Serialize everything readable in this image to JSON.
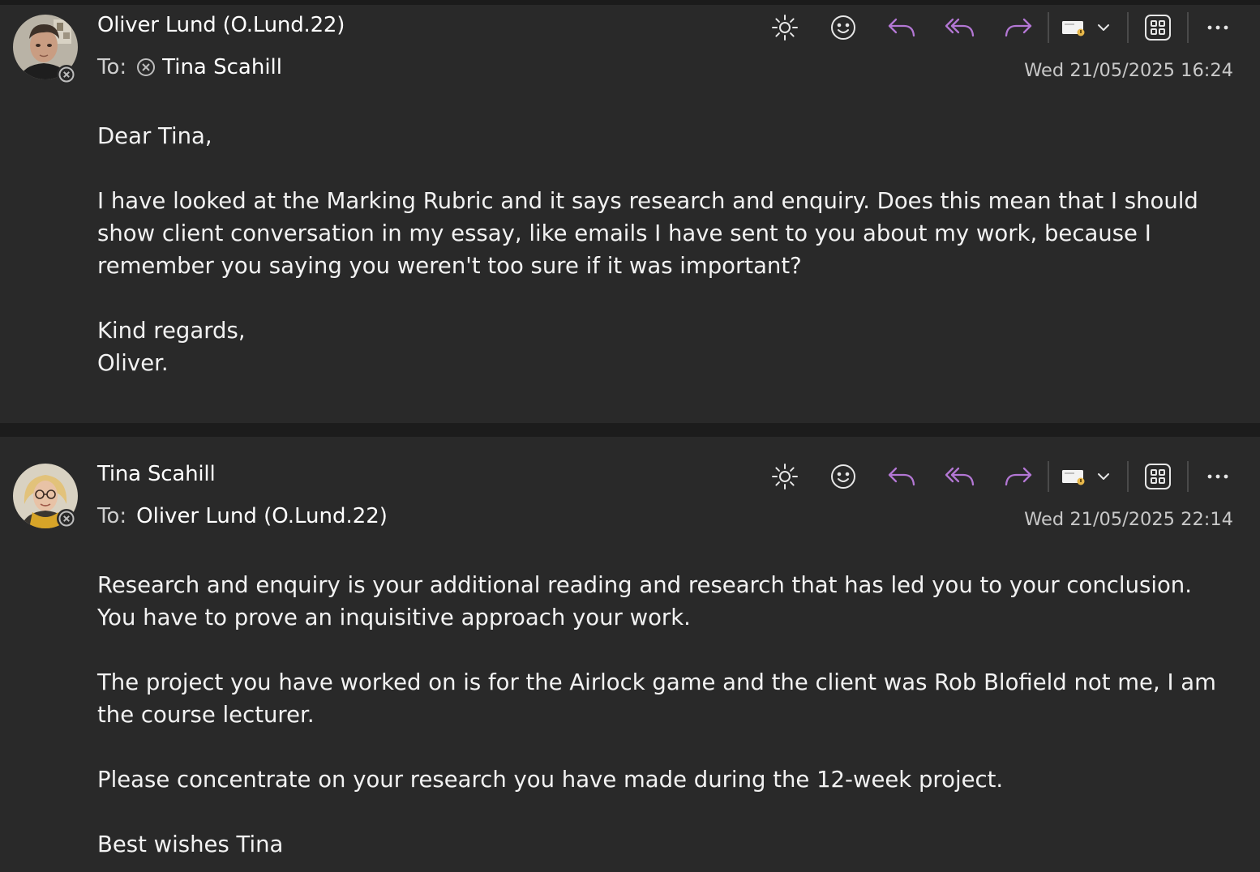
{
  "colors": {
    "background": "#292929",
    "accent_purple": "#b377d4",
    "text": "#ffffff",
    "muted": "#c8c8c8"
  },
  "toolbar_icons": [
    "brightness-icon",
    "emoji-icon",
    "reply-icon",
    "reply-all-icon",
    "forward-icon",
    "tag-icon",
    "chevron-down-icon",
    "apps-icon",
    "more-icon"
  ],
  "messages": [
    {
      "sender": "Oliver Lund (O.Lund.22)",
      "to_label": "To:",
      "recipient": "Tina Scahill",
      "date": "Wed 21/05/2025 16:24",
      "body": {
        "greeting": "Dear Tina,",
        "paragraph1": "I have looked at the Marking Rubric and it says research and enquiry. Does this mean that I should show client conversation in my essay, like emails I have sent to you about my work, because I remember you saying you weren't too sure if it was important?",
        "signoff": "Kind regards,",
        "signature": "Oliver."
      }
    },
    {
      "sender": "Tina Scahill",
      "to_label": "To:",
      "recipient": "Oliver Lund (O.Lund.22)",
      "date": "Wed 21/05/2025 22:14",
      "body": {
        "paragraph1": "Research and enquiry is your additional reading and research that has led you to your conclusion. You have to prove an inquisitive approach your work.",
        "paragraph2": "The project you have worked on is for the Airlock game and the client was Rob Blofield not me, I am the course lecturer.",
        "paragraph3": "Please concentrate on your research you have made during the 12-week project.",
        "signoff": "Best wishes Tina"
      }
    }
  ]
}
